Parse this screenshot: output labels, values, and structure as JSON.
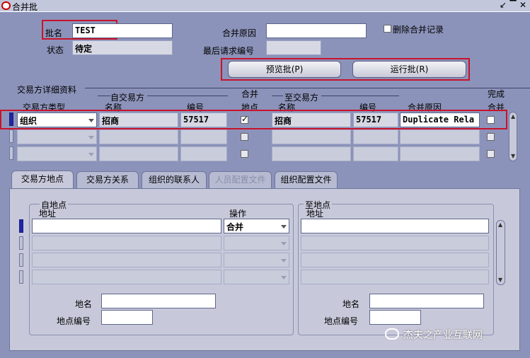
{
  "window": {
    "title": "合并批"
  },
  "header": {
    "batch_name_label": "批名",
    "batch_name_value": "TEST",
    "status_label": "状态",
    "status_value": "待定",
    "merge_reason_label": "合并原因",
    "merge_reason_value": "",
    "last_request_label": "最后请求编号",
    "last_request_value": "",
    "delete_merge_label": "删除合并记录",
    "preview_button": "预览批(P)",
    "run_button": "运行批(R)"
  },
  "details": {
    "section_title": "交易方详细资料",
    "from_group_title": "自交易方",
    "to_group_title": "至交易方",
    "col_party_type": "交易方类型",
    "col_from_name": "名称",
    "col_from_number": "编号",
    "col_merge_site_top": "合并",
    "col_merge_site_bottom": "地点",
    "col_to_name": "名称",
    "col_to_number": "编号",
    "col_merge_reason": "合并原因",
    "col_done_top": "完成",
    "col_done_bottom": "合并",
    "rows": [
      {
        "party_type": "组织",
        "from_name": "招商",
        "from_number": "57517",
        "merge_sites": true,
        "to_name": "招商",
        "to_number": "57517",
        "reason": "Duplicate Rela",
        "done": false
      },
      {
        "party_type": "",
        "from_name": "",
        "from_number": "",
        "merge_sites": false,
        "to_name": "",
        "to_number": "",
        "reason": "",
        "done": false
      },
      {
        "party_type": "",
        "from_name": "",
        "from_number": "",
        "merge_sites": false,
        "to_name": "",
        "to_number": "",
        "reason": "",
        "done": false
      }
    ]
  },
  "tabs": [
    {
      "label": "交易方地点",
      "active": true,
      "disabled": false
    },
    {
      "label": "交易方关系",
      "active": false,
      "disabled": false
    },
    {
      "label": "组织的联系人",
      "active": false,
      "disabled": false
    },
    {
      "label": "人员配置文件",
      "active": false,
      "disabled": true
    },
    {
      "label": "组织配置文件",
      "active": false,
      "disabled": false
    }
  ],
  "sites": {
    "from_group_title": "自地点",
    "from_address_label": "地址",
    "action_label": "操作",
    "action_value": "合并",
    "to_group_title": "至地点",
    "to_address_label": "地址",
    "from_site_name_label": "地名",
    "from_site_number_label": "地点编号",
    "to_site_name_label": "地名",
    "to_site_number_label": "地点编号"
  },
  "watermark": "杰夫之产业互联网"
}
